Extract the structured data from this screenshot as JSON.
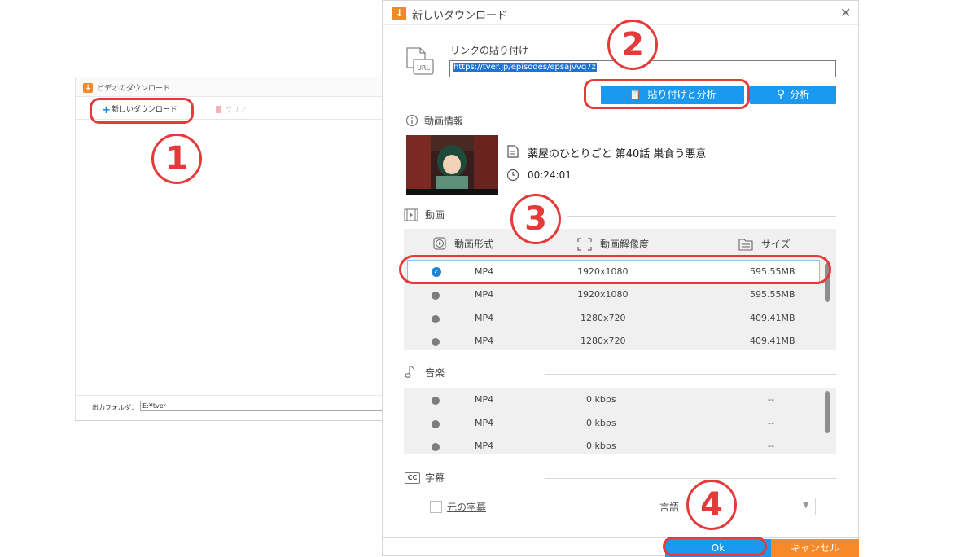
{
  "background_window": {
    "title": "ビデオのダウンロード",
    "new_download_label": "新しいダウンロード",
    "clear_label": "クリア",
    "output_folder_label": "出力フォルダ：",
    "output_folder_value": "E:¥tver"
  },
  "dialog": {
    "title": "新しいダウンロード",
    "paste_link_label": "リンクの貼り付け",
    "url_icon_text": "URL",
    "url_value": "https://tver.jp/episodes/epsajvvq7z",
    "paste_analyze_label": "貼り付けと分析",
    "analyze_label": "分析",
    "video_info_label": "動画情報",
    "video_title": "薬屋のひとりごと 第40話 巣食う悪意",
    "video_duration": "00:24:01",
    "video_section_label": "動画",
    "video_columns": {
      "format": "動画形式",
      "resolution": "動画解像度",
      "size": "サイズ"
    },
    "video_rows": [
      {
        "format": "MP4",
        "resolution": "1920x1080",
        "size": "595.55MB",
        "selected": true
      },
      {
        "format": "MP4",
        "resolution": "1920x1080",
        "size": "595.55MB",
        "selected": false
      },
      {
        "format": "MP4",
        "resolution": "1280x720",
        "size": "409.41MB",
        "selected": false
      },
      {
        "format": "MP4",
        "resolution": "1280x720",
        "size": "409.41MB",
        "selected": false
      }
    ],
    "music_section_label": "音楽",
    "music_rows": [
      {
        "format": "MP4",
        "bitrate": "0 kbps",
        "size": "--"
      },
      {
        "format": "MP4",
        "bitrate": "0 kbps",
        "size": "--"
      },
      {
        "format": "MP4",
        "bitrate": "0 kbps",
        "size": "--"
      }
    ],
    "subtitle_section_label": "字幕",
    "subtitle_icon_text": "CC",
    "original_subtitle_label": "元の字幕",
    "language_label": "言語",
    "language_value": "",
    "ok_label": "Ok",
    "cancel_label": "キャンセル"
  },
  "annotations": {
    "step1": "1",
    "step2": "2",
    "step3": "3",
    "step4": "4"
  },
  "colors": {
    "accent_blue": "#1a99f0",
    "cancel_orange": "#f7892b",
    "annotation_red": "#e53a3a",
    "app_icon": "#f08a24"
  }
}
